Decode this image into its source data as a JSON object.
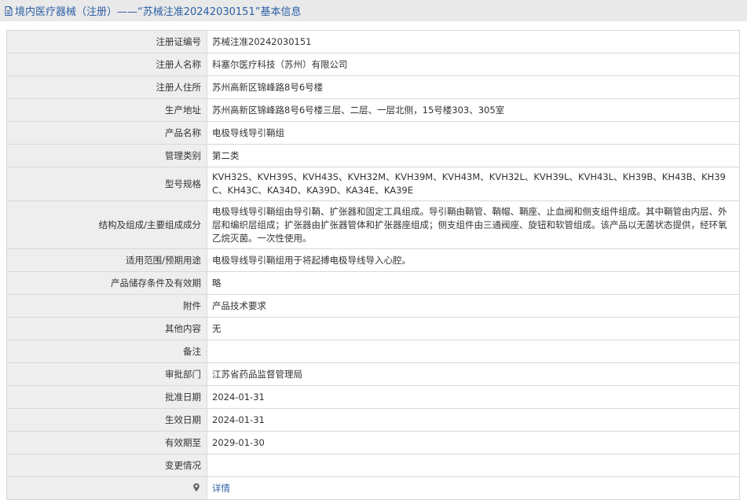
{
  "header": {
    "title": "境内医疗器械（注册）——“苏械注准20242030151”基本信息"
  },
  "rows": [
    {
      "label": "注册证编号",
      "value": "苏械注准20242030151"
    },
    {
      "label": "注册人名称",
      "value": "科塞尔医疗科技（苏州）有限公司"
    },
    {
      "label": "注册人住所",
      "value": "苏州高新区锦峰路8号6号楼"
    },
    {
      "label": "生产地址",
      "value": "苏州高新区锦峰路8号6号楼三层、二层、一层北侧，15号楼303、305室"
    },
    {
      "label": "产品名称",
      "value": "电极导线导引鞘组"
    },
    {
      "label": "管理类别",
      "value": "第二类"
    },
    {
      "label": "型号规格",
      "value": "KVH32S、KVH39S、KVH43S、KVH32M、KVH39M、KVH43M、KVH32L、KVH39L、KVH43L、KH39B、KH43B、KH39C、KH43C、KA34D、KA39D、KA34E、KA39E"
    },
    {
      "label": "结构及组成/主要组成成分",
      "value": "电极导线导引鞘组由导引鞘、扩张器和固定工具组成。导引鞘由鞘管、鞘帽、鞘座、止血阀和侧支组件组成。其中鞘管由内层、外层和编织层组成；扩张器由扩张器管体和扩张器座组成；侧支组件由三通阀座、旋钮和软管组成。该产品以无菌状态提供，经环氧乙烷灭菌。一次性使用。"
    },
    {
      "label": "适用范围/预期用途",
      "value": "电极导线导引鞘组用于将起搏电极导线导入心腔。"
    },
    {
      "label": "产品储存条件及有效期",
      "value": "略"
    },
    {
      "label": "附件",
      "value": "产品技术要求"
    },
    {
      "label": "其他内容",
      "value": "无"
    },
    {
      "label": "备注",
      "value": ""
    },
    {
      "label": "审批部门",
      "value": "江苏省药品监督管理局"
    },
    {
      "label": "批准日期",
      "value": "2024-01-31"
    },
    {
      "label": "生效日期",
      "value": "2024-01-31"
    },
    {
      "label": "有效期至",
      "value": "2029-01-30"
    },
    {
      "label": "变更情况",
      "value": ""
    }
  ],
  "footer_row": {
    "icon": "location-pin-icon",
    "link_label": "详情"
  },
  "colors": {
    "header_bg": "#e9e9e9",
    "header_text": "#2b5fa5",
    "label_bg": "#eeeeee",
    "border": "#d8d8d8",
    "link": "#2b5fa5"
  }
}
